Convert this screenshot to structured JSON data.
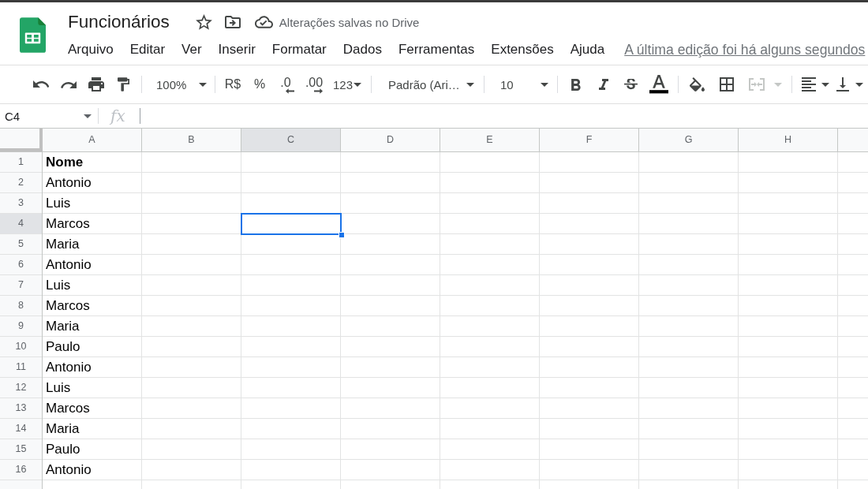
{
  "document": {
    "title": "Funcionários",
    "starred": false,
    "save_status": "Alterações salvas no Drive"
  },
  "menu": [
    "Arquivo",
    "Editar",
    "Ver",
    "Inserir",
    "Formatar",
    "Dados",
    "Ferramentas",
    "Extensões",
    "Ajuda"
  ],
  "last_edit": "A última edição foi há alguns segundos",
  "toolbar": {
    "zoom": "100%",
    "currency": "R$",
    "percent": "%",
    "decrease_decimals": ".0",
    "increase_decimals": ".00",
    "number_format": "123",
    "font": "Padrão (Ari…",
    "font_size": "10",
    "merge": {
      "disabled": true
    }
  },
  "formula_bar": {
    "cell_reference": "C4",
    "function_label": "fx"
  },
  "grid": {
    "columns": [
      {
        "label": "A",
        "selected": false
      },
      {
        "label": "B",
        "selected": false
      },
      {
        "label": "C",
        "selected": true
      },
      {
        "label": "D",
        "selected": false
      },
      {
        "label": "E",
        "selected": false
      },
      {
        "label": "F",
        "selected": false
      },
      {
        "label": "G",
        "selected": false
      },
      {
        "label": "H",
        "selected": false
      }
    ],
    "rows": [
      {
        "number": "1",
        "selected": false,
        "cells": [
          {
            "text": "Nome",
            "bold": true
          }
        ]
      },
      {
        "number": "2",
        "selected": false,
        "cells": [
          {
            "text": "Antonio",
            "bold": false
          }
        ]
      },
      {
        "number": "3",
        "selected": false,
        "cells": [
          {
            "text": "Luis",
            "bold": false
          }
        ]
      },
      {
        "number": "4",
        "selected": true,
        "cells": [
          {
            "text": "Marcos",
            "bold": false
          }
        ]
      },
      {
        "number": "5",
        "selected": false,
        "cells": [
          {
            "text": "Maria",
            "bold": false
          }
        ]
      },
      {
        "number": "6",
        "selected": false,
        "cells": [
          {
            "text": "Antonio",
            "bold": false
          }
        ]
      },
      {
        "number": "7",
        "selected": false,
        "cells": [
          {
            "text": "Luis",
            "bold": false
          }
        ]
      },
      {
        "number": "8",
        "selected": false,
        "cells": [
          {
            "text": "Marcos",
            "bold": false
          }
        ]
      },
      {
        "number": "9",
        "selected": false,
        "cells": [
          {
            "text": "Maria",
            "bold": false
          }
        ]
      },
      {
        "number": "10",
        "selected": false,
        "cells": [
          {
            "text": "Paulo",
            "bold": false
          }
        ]
      },
      {
        "number": "11",
        "selected": false,
        "cells": [
          {
            "text": "Antonio",
            "bold": false
          }
        ]
      },
      {
        "number": "12",
        "selected": false,
        "cells": [
          {
            "text": "Luis",
            "bold": false
          }
        ]
      },
      {
        "number": "13",
        "selected": false,
        "cells": [
          {
            "text": "Marcos",
            "bold": false
          }
        ]
      },
      {
        "number": "14",
        "selected": false,
        "cells": [
          {
            "text": "Maria",
            "bold": false
          }
        ]
      },
      {
        "number": "15",
        "selected": false,
        "cells": [
          {
            "text": "Paulo",
            "bold": false
          }
        ]
      },
      {
        "number": "16",
        "selected": false,
        "cells": [
          {
            "text": "Antonio",
            "bold": false
          }
        ]
      }
    ]
  }
}
